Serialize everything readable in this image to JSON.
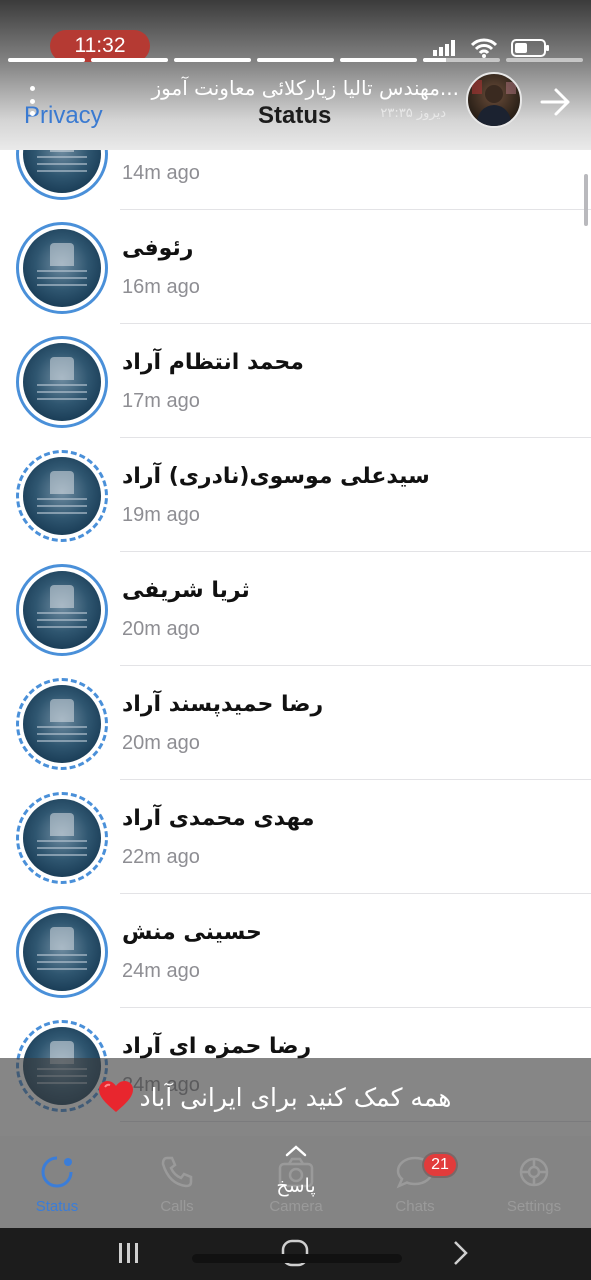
{
  "status_bar": {
    "time": "11:32"
  },
  "story": {
    "progress": [
      1,
      1,
      1,
      1,
      1,
      0.3,
      0
    ],
    "poster_name": "مهندس تالیا زیارکلائی معاونت آموز...",
    "poster_time": "دیروز ۲۳:۳۵"
  },
  "whatsapp_header": {
    "privacy": "Privacy",
    "title": "Status"
  },
  "contacts": [
    {
      "name": "",
      "time": "14m ago",
      "ring": "solid"
    },
    {
      "name": "رئوفی",
      "time": "16m ago",
      "ring": "solid"
    },
    {
      "name": "محمد انتظام آراد",
      "time": "17m ago",
      "ring": "solid"
    },
    {
      "name": "سیدعلی موسوی(نادری) آراد",
      "time": "19m ago",
      "ring": "dashed"
    },
    {
      "name": "ثریا شریفی",
      "time": "20m ago",
      "ring": "solid"
    },
    {
      "name": "رضا حمیدپسند آراد",
      "time": "20m ago",
      "ring": "dashed"
    },
    {
      "name": "مهدی محمدی آراد",
      "time": "22m ago",
      "ring": "dashed"
    },
    {
      "name": "حسینی منش",
      "time": "24m ago",
      "ring": "solid"
    },
    {
      "name": "رضا حمزه ای آراد",
      "time": "24m ago",
      "ring": "dashed"
    }
  ],
  "caption": "همه کمک کنید برای ایرانی آباد",
  "reply_label": "پاسخ",
  "tabs": [
    {
      "label": "Status",
      "icon": "status-icon",
      "active": true
    },
    {
      "label": "Calls",
      "icon": "phone-icon",
      "active": false
    },
    {
      "label": "Camera",
      "icon": "camera-icon",
      "active": false
    },
    {
      "label": "Chats",
      "icon": "chat-bubble-icon",
      "active": false,
      "badge": "21"
    },
    {
      "label": "Settings",
      "icon": "gear-icon",
      "active": false
    }
  ],
  "colors": {
    "accent": "#3b7dd8",
    "badge": "#e23b3b",
    "time_pill": "#b53a33"
  }
}
